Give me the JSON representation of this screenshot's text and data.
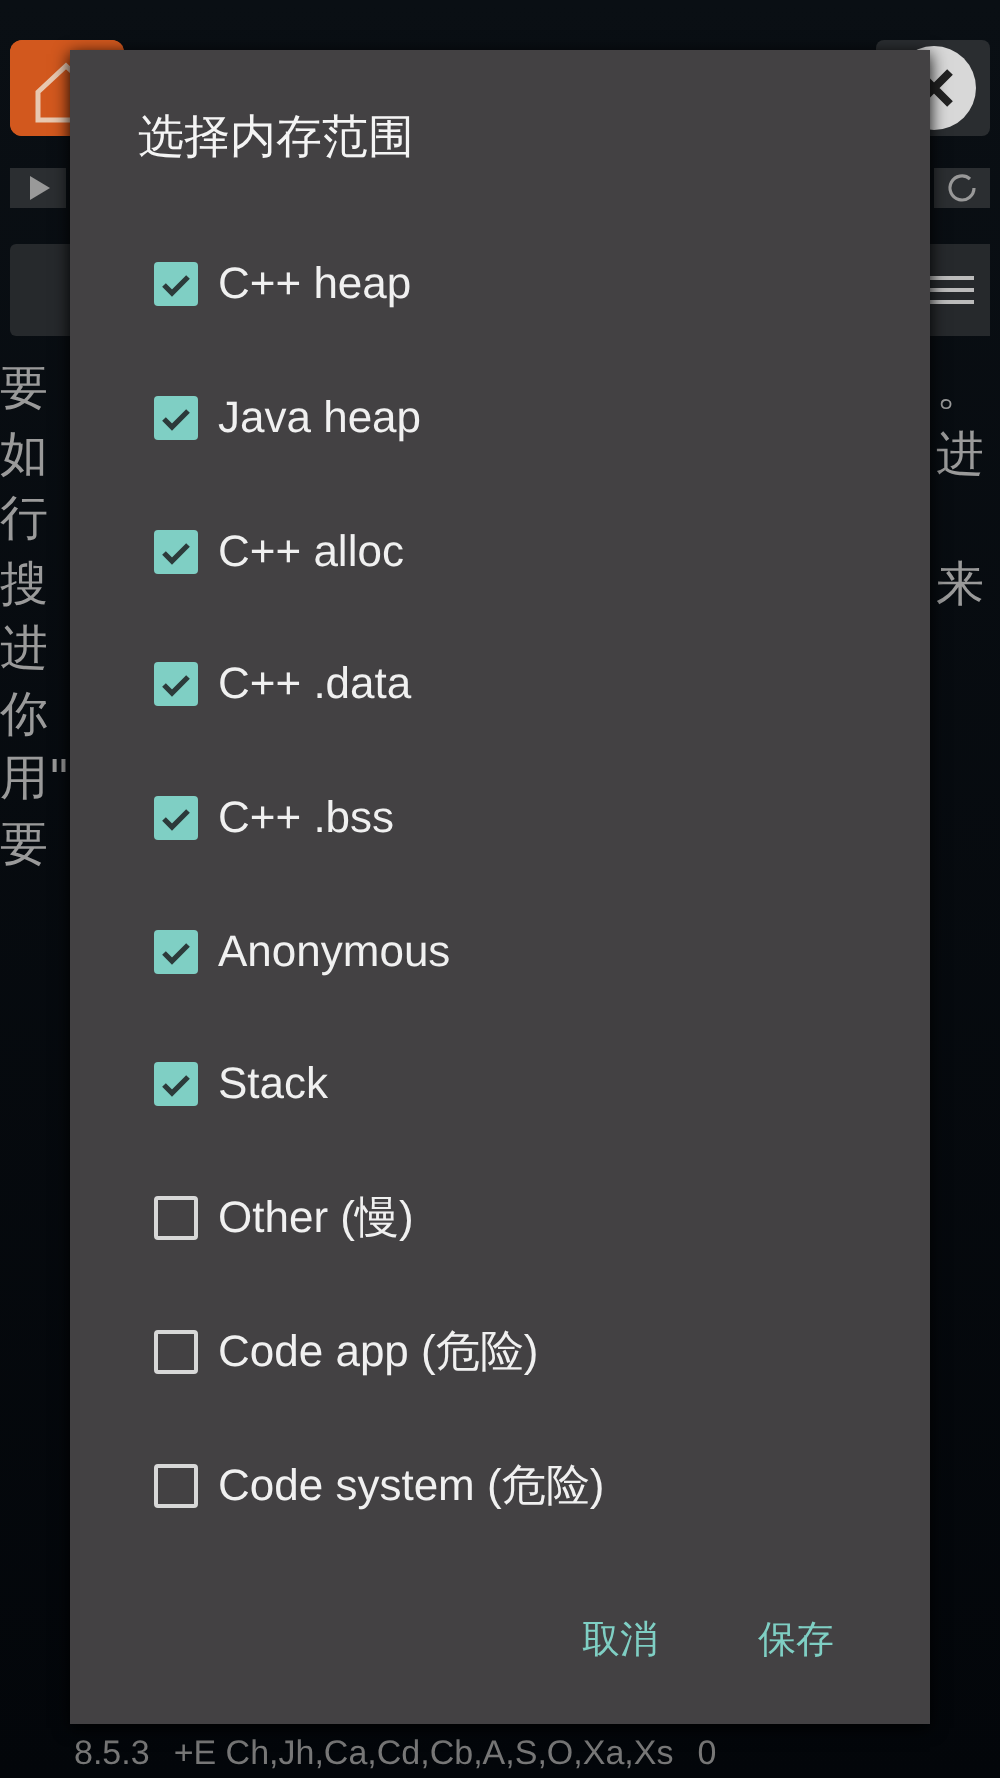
{
  "text_lines": [
    {
      "start": "要",
      "end": "。"
    },
    {
      "start": "如",
      "end": "进"
    },
    {
      "start": "行"
    },
    {
      "start": "搜",
      "end": "来"
    },
    {
      "start": "进"
    },
    {
      "start": "你"
    },
    {
      "start": "用\""
    },
    {
      "start": "要"
    }
  ],
  "status_bar": {
    "version": "8.5.3",
    "flags": "+E Ch,Jh,Ca,Cd,Cb,A,S,O,Xa,Xs",
    "count": "0"
  },
  "dialog": {
    "title": "选择内存范围",
    "options": [
      {
        "label": "C++ heap",
        "checked": true
      },
      {
        "label": "Java heap",
        "checked": true
      },
      {
        "label": "C++ alloc",
        "checked": true
      },
      {
        "label": "C++ .data",
        "checked": true
      },
      {
        "label": "C++ .bss",
        "checked": true
      },
      {
        "label": "Anonymous",
        "checked": true
      },
      {
        "label": "Stack",
        "checked": true
      },
      {
        "label": "Other (慢)",
        "checked": false
      },
      {
        "label": "Code app (危险)",
        "checked": false
      },
      {
        "label": "Code system (危险)",
        "checked": false
      }
    ],
    "buttons": [
      {
        "label": "取消"
      },
      {
        "label": "保存"
      }
    ]
  }
}
